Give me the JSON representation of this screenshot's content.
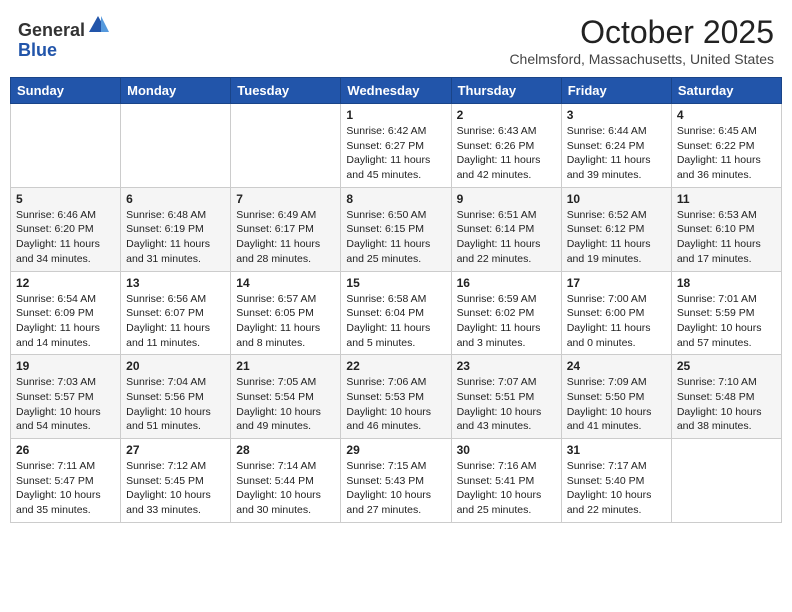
{
  "logo": {
    "general": "General",
    "blue": "Blue"
  },
  "title": "October 2025",
  "subtitle": "Chelmsford, Massachusetts, United States",
  "days_of_week": [
    "Sunday",
    "Monday",
    "Tuesday",
    "Wednesday",
    "Thursday",
    "Friday",
    "Saturday"
  ],
  "weeks": [
    [
      {
        "day": "",
        "info": ""
      },
      {
        "day": "",
        "info": ""
      },
      {
        "day": "",
        "info": ""
      },
      {
        "day": "1",
        "info": "Sunrise: 6:42 AM\nSunset: 6:27 PM\nDaylight: 11 hours\nand 45 minutes."
      },
      {
        "day": "2",
        "info": "Sunrise: 6:43 AM\nSunset: 6:26 PM\nDaylight: 11 hours\nand 42 minutes."
      },
      {
        "day": "3",
        "info": "Sunrise: 6:44 AM\nSunset: 6:24 PM\nDaylight: 11 hours\nand 39 minutes."
      },
      {
        "day": "4",
        "info": "Sunrise: 6:45 AM\nSunset: 6:22 PM\nDaylight: 11 hours\nand 36 minutes."
      }
    ],
    [
      {
        "day": "5",
        "info": "Sunrise: 6:46 AM\nSunset: 6:20 PM\nDaylight: 11 hours\nand 34 minutes."
      },
      {
        "day": "6",
        "info": "Sunrise: 6:48 AM\nSunset: 6:19 PM\nDaylight: 11 hours\nand 31 minutes."
      },
      {
        "day": "7",
        "info": "Sunrise: 6:49 AM\nSunset: 6:17 PM\nDaylight: 11 hours\nand 28 minutes."
      },
      {
        "day": "8",
        "info": "Sunrise: 6:50 AM\nSunset: 6:15 PM\nDaylight: 11 hours\nand 25 minutes."
      },
      {
        "day": "9",
        "info": "Sunrise: 6:51 AM\nSunset: 6:14 PM\nDaylight: 11 hours\nand 22 minutes."
      },
      {
        "day": "10",
        "info": "Sunrise: 6:52 AM\nSunset: 6:12 PM\nDaylight: 11 hours\nand 19 minutes."
      },
      {
        "day": "11",
        "info": "Sunrise: 6:53 AM\nSunset: 6:10 PM\nDaylight: 11 hours\nand 17 minutes."
      }
    ],
    [
      {
        "day": "12",
        "info": "Sunrise: 6:54 AM\nSunset: 6:09 PM\nDaylight: 11 hours\nand 14 minutes."
      },
      {
        "day": "13",
        "info": "Sunrise: 6:56 AM\nSunset: 6:07 PM\nDaylight: 11 hours\nand 11 minutes."
      },
      {
        "day": "14",
        "info": "Sunrise: 6:57 AM\nSunset: 6:05 PM\nDaylight: 11 hours\nand 8 minutes."
      },
      {
        "day": "15",
        "info": "Sunrise: 6:58 AM\nSunset: 6:04 PM\nDaylight: 11 hours\nand 5 minutes."
      },
      {
        "day": "16",
        "info": "Sunrise: 6:59 AM\nSunset: 6:02 PM\nDaylight: 11 hours\nand 3 minutes."
      },
      {
        "day": "17",
        "info": "Sunrise: 7:00 AM\nSunset: 6:00 PM\nDaylight: 11 hours\nand 0 minutes."
      },
      {
        "day": "18",
        "info": "Sunrise: 7:01 AM\nSunset: 5:59 PM\nDaylight: 10 hours\nand 57 minutes."
      }
    ],
    [
      {
        "day": "19",
        "info": "Sunrise: 7:03 AM\nSunset: 5:57 PM\nDaylight: 10 hours\nand 54 minutes."
      },
      {
        "day": "20",
        "info": "Sunrise: 7:04 AM\nSunset: 5:56 PM\nDaylight: 10 hours\nand 51 minutes."
      },
      {
        "day": "21",
        "info": "Sunrise: 7:05 AM\nSunset: 5:54 PM\nDaylight: 10 hours\nand 49 minutes."
      },
      {
        "day": "22",
        "info": "Sunrise: 7:06 AM\nSunset: 5:53 PM\nDaylight: 10 hours\nand 46 minutes."
      },
      {
        "day": "23",
        "info": "Sunrise: 7:07 AM\nSunset: 5:51 PM\nDaylight: 10 hours\nand 43 minutes."
      },
      {
        "day": "24",
        "info": "Sunrise: 7:09 AM\nSunset: 5:50 PM\nDaylight: 10 hours\nand 41 minutes."
      },
      {
        "day": "25",
        "info": "Sunrise: 7:10 AM\nSunset: 5:48 PM\nDaylight: 10 hours\nand 38 minutes."
      }
    ],
    [
      {
        "day": "26",
        "info": "Sunrise: 7:11 AM\nSunset: 5:47 PM\nDaylight: 10 hours\nand 35 minutes."
      },
      {
        "day": "27",
        "info": "Sunrise: 7:12 AM\nSunset: 5:45 PM\nDaylight: 10 hours\nand 33 minutes."
      },
      {
        "day": "28",
        "info": "Sunrise: 7:14 AM\nSunset: 5:44 PM\nDaylight: 10 hours\nand 30 minutes."
      },
      {
        "day": "29",
        "info": "Sunrise: 7:15 AM\nSunset: 5:43 PM\nDaylight: 10 hours\nand 27 minutes."
      },
      {
        "day": "30",
        "info": "Sunrise: 7:16 AM\nSunset: 5:41 PM\nDaylight: 10 hours\nand 25 minutes."
      },
      {
        "day": "31",
        "info": "Sunrise: 7:17 AM\nSunset: 5:40 PM\nDaylight: 10 hours\nand 22 minutes."
      },
      {
        "day": "",
        "info": ""
      }
    ]
  ]
}
